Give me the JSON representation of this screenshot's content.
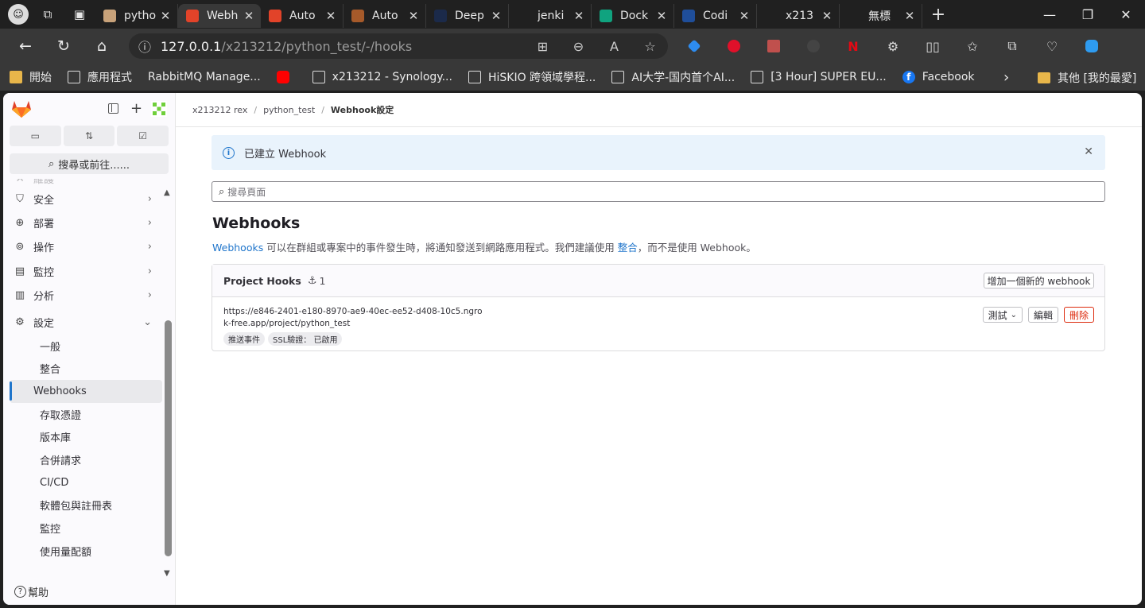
{
  "browser": {
    "tabs": [
      {
        "label": "pytho",
        "fav_color": "#c8a27a",
        "active": false
      },
      {
        "label": "Webh",
        "fav_color": "#e24329",
        "active": true
      },
      {
        "label": "Auto",
        "fav_color": "#e24329",
        "active": false
      },
      {
        "label": "Auto",
        "fav_color": "#a65a2a",
        "active": false
      },
      {
        "label": "Deep",
        "fav_color": "#1b2a4a",
        "active": false
      },
      {
        "label": "jenki",
        "fav_color": "#202020",
        "active": false
      },
      {
        "label": "Dock",
        "fav_color": "#10a37f",
        "active": false
      },
      {
        "label": "Codi",
        "fav_color": "#1f4e9a",
        "active": false
      },
      {
        "label": "x213",
        "fav_color": "#202020",
        "active": false
      },
      {
        "label": "無標",
        "fav_color": "#202020",
        "active": false
      }
    ],
    "url_host": "127.0.0.1",
    "url_path": "/x213212/python_test/-/hooks",
    "bookmarks": [
      {
        "label": "開始",
        "icon": "folder"
      },
      {
        "label": "應用程式",
        "icon": "page"
      },
      {
        "label": "RabbitMQ Manage...",
        "icon": "none"
      },
      {
        "label": "",
        "icon": "yt"
      },
      {
        "label": "x213212 - Synology...",
        "icon": "page"
      },
      {
        "label": "HiSKIO 跨領域學程...",
        "icon": "page"
      },
      {
        "label": "AI大学-国内首个AI...",
        "icon": "page"
      },
      {
        "label": "[3 Hour] SUPER EU...",
        "icon": "page"
      },
      {
        "label": "Facebook",
        "icon": "fb"
      }
    ],
    "bookmarks_other": "其他 [我的最愛]"
  },
  "sidebar": {
    "search_label": "搜尋或前往......",
    "partial_item": "維護",
    "items": [
      {
        "label": "安全",
        "icon": "shield-icon",
        "glyph": "⛉"
      },
      {
        "label": "部署",
        "icon": "deploy-icon",
        "glyph": "⊕"
      },
      {
        "label": "操作",
        "icon": "operate-icon",
        "glyph": "⊚"
      },
      {
        "label": "監控",
        "icon": "monitor-icon",
        "glyph": "▤"
      },
      {
        "label": "分析",
        "icon": "analytics-icon",
        "glyph": "▥"
      }
    ],
    "settings_label": "設定",
    "sub_items": [
      "一般",
      "整合",
      "Webhooks",
      "存取憑證",
      "版本庫",
      "合併請求",
      "CI/CD",
      "軟體包與註冊表",
      "監控",
      "使用量配額"
    ],
    "active_sub": "Webhooks",
    "help_label": "幫助"
  },
  "breadcrumb": {
    "items": [
      "x213212 rex",
      "python_test"
    ],
    "current": "Webhook設定"
  },
  "alert": {
    "text": "已建立 Webhook"
  },
  "search_page": {
    "placeholder": "搜尋頁面"
  },
  "heading": "Webhooks",
  "description": {
    "link1": "Webhooks",
    "part1": " 可以在群組或專案中的事件發生時，將通知發送到網路應用程式。我們建議使用 ",
    "link2": "整合",
    "part2": "，而不是使用 Webhook。"
  },
  "hooks_card": {
    "title": "Project Hooks",
    "count": "1",
    "add_button": "增加一個新的 webhook",
    "hook": {
      "url": "https://e846-2401-e180-8970-ae9-40ec-ee52-d408-10c5.ngrok-free.app/project/python_test",
      "tags": [
        "推送事件",
        "SSL驗證： 已啟用"
      ],
      "test_button": "測試",
      "edit_button": "編輯",
      "delete_button": "刪除"
    }
  },
  "colors": {
    "link": "#1f75cb",
    "danger": "#dd2b0e",
    "alert_bg": "#e9f3fc",
    "gitlab_orange": "#e24329"
  }
}
